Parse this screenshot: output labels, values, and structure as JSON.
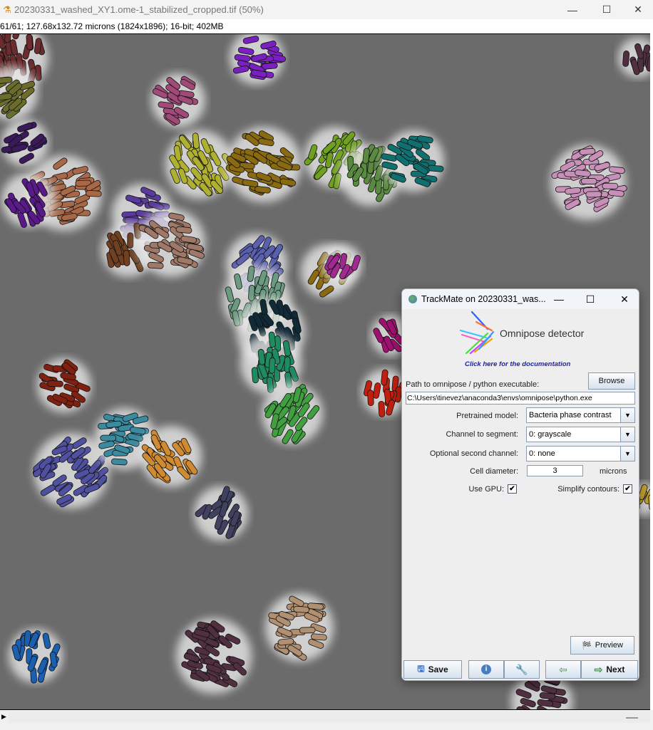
{
  "window": {
    "title": "20230331_washed_XY1.ome-1_stabilized_cropped.tif (50%)",
    "icon": "microscope-icon",
    "minimize": "—",
    "maximize": "☐",
    "close": "✕"
  },
  "image_info": "61/61; 127.68x132.72 microns (1824x1896); 16-bit; 402MB",
  "image": {
    "background": "#6b6b6b",
    "cell_colors": [
      "#6a2c2c",
      "#6b6b2a",
      "#3a1a5a",
      "#7a3a10",
      "#a86848",
      "#5a1a8a",
      "#7a20c0",
      "#a04a78",
      "#b0b030",
      "#8a6a10",
      "#70a020",
      "#5a8a40",
      "#107070",
      "#c890b8",
      "#5a3a9a",
      "#704020",
      "#a07868",
      "#5a60b0",
      "#6a9a80",
      "#102a38",
      "#208a60",
      "#40a040",
      "#802010",
      "#5050a0",
      "#3a8aa0",
      "#d08a30",
      "#404060",
      "#b09070",
      "#503040",
      "#1a5fb0",
      "#a01070",
      "#c02010",
      "#a02a90",
      "#c0a030"
    ]
  },
  "dialog": {
    "title": "TrackMate on 20230331_was...",
    "minimize": "—",
    "maximize": "☐",
    "close": "✕",
    "header": "Omnipose detector",
    "doc_link": "Click here for the documentation",
    "path_label": "Path to omnipose / python executable:",
    "browse": "Browse",
    "path_value": "C:\\Users\\tinevez\\anaconda3\\envs\\omnipose\\python.exe",
    "model_label": "Pretrained model:",
    "model_value": "Bacteria phase contrast",
    "channel_label": "Channel to segment:",
    "channel_value": "0: grayscale",
    "channel2_label": "Optional second channel:",
    "channel2_value": "0: none",
    "diameter_label": "Cell diameter:",
    "diameter_value": "3",
    "diameter_unit": "microns",
    "gpu_label": "Use GPU:",
    "gpu_checked": true,
    "simplify_label": "Simplify contours:",
    "simplify_checked": true,
    "check_mark": "✔",
    "preview": "Preview",
    "save": "Save",
    "next": "Next"
  }
}
